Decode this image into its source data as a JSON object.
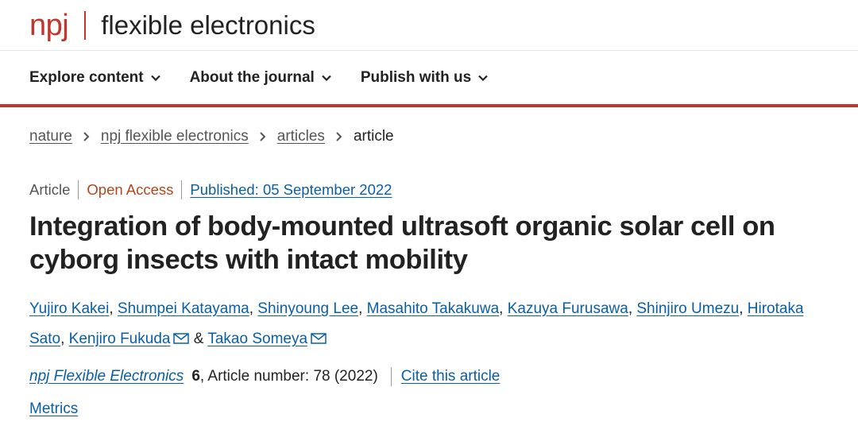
{
  "header": {
    "logo_prefix": "npj",
    "logo_name": "flexible electronics"
  },
  "nav": {
    "items": [
      {
        "label": "Explore content"
      },
      {
        "label": "About the journal"
      },
      {
        "label": "Publish with us"
      }
    ]
  },
  "breadcrumb": {
    "items": [
      "nature",
      "npj flexible electronics",
      "articles"
    ],
    "current": "article"
  },
  "article": {
    "type": "Article",
    "access": "Open Access",
    "published": "Published: 05 September 2022",
    "title": "Integration of body-mounted ultrasoft organic solar cell on cyborg insects with intact mobility",
    "authors": [
      "Yujiro Kakei",
      "Shumpei Katayama",
      "Shinyoung Lee",
      "Masahito Takakuwa",
      "Kazuya Furusawa",
      "Shinjiro Umezu",
      "Hirotaka Sato",
      "Kenjiro Fukuda",
      "Takao Someya"
    ],
    "author_separator": ", ",
    "final_separator": " & ",
    "journal": "npj Flexible Electronics",
    "volume": "6",
    "article_number": ", Article number: 78 (2022)",
    "cite_label": "Cite this article",
    "metrics_label": "Metrics"
  },
  "colors": {
    "brand": "#c0362c",
    "link": "#0a5ea8",
    "open_access": "#b5451b"
  }
}
